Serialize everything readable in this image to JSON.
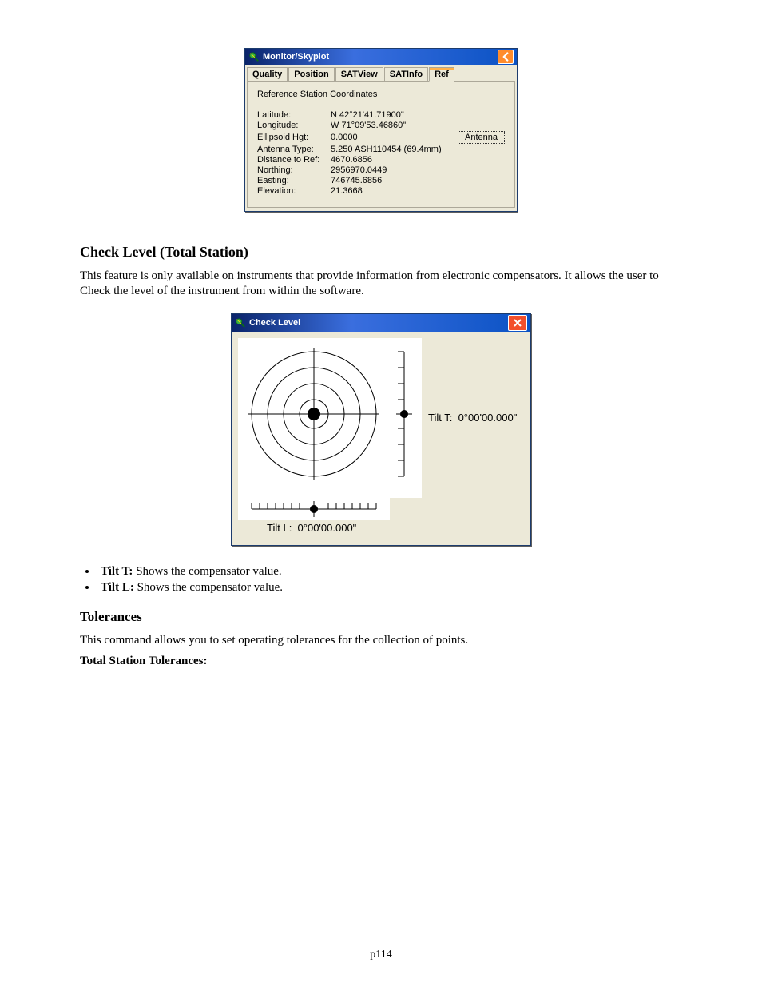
{
  "monitor_dialog": {
    "title": "Monitor/Skyplot",
    "back_label": "←",
    "tabs": {
      "quality": "Quality",
      "position": "Position",
      "satview": "SATView",
      "satinfo": "SATInfo",
      "ref": "Ref"
    },
    "heading": "Reference Station Coordinates",
    "rows": {
      "latitude": {
        "label": "Latitude:",
        "value": "N 42°21'41.71900\""
      },
      "longitude": {
        "label": "Longitude:",
        "value": "W 71°09'53.46860\""
      },
      "ellipsoid_hgt": {
        "label": "Ellipsoid Hgt:",
        "value": "0.0000"
      },
      "antenna_type": {
        "label": "Antenna Type:",
        "value": "5.250 ASH110454 (69.4mm)"
      },
      "distance_to_ref": {
        "label": "Distance to Ref:",
        "value": "4670.6856"
      },
      "northing": {
        "label": "Northing:",
        "value": "2956970.0449"
      },
      "easting": {
        "label": "Easting:",
        "value": "746745.6856"
      },
      "elevation": {
        "label": "Elevation:",
        "value": "21.3668"
      }
    },
    "antenna_button": "Antenna"
  },
  "section1": {
    "heading": "Check Level (Total Station)",
    "para": "This feature is only available on instruments that provide information from electronic compensators. It allows the user to Check the level of the instrument from within the software."
  },
  "check_level_dialog": {
    "title": "Check Level",
    "tilt_t_label": "Tilt T:",
    "tilt_t_value": "0°00'00.000\"",
    "tilt_l_label": "Tilt L:",
    "tilt_l_value": "0°00'00.000\""
  },
  "bullets": {
    "tilt_t_name": "Tilt T:",
    "tilt_t_desc": " Shows the compensator value.",
    "tilt_l_name": "Tilt L:",
    "tilt_l_desc": " Shows the compensator value."
  },
  "section2": {
    "heading": "Tolerances",
    "para": "This command allows you to set operating tolerances for the collection of points.",
    "subheading": "Total Station Tolerances:"
  },
  "page_number": "p114"
}
